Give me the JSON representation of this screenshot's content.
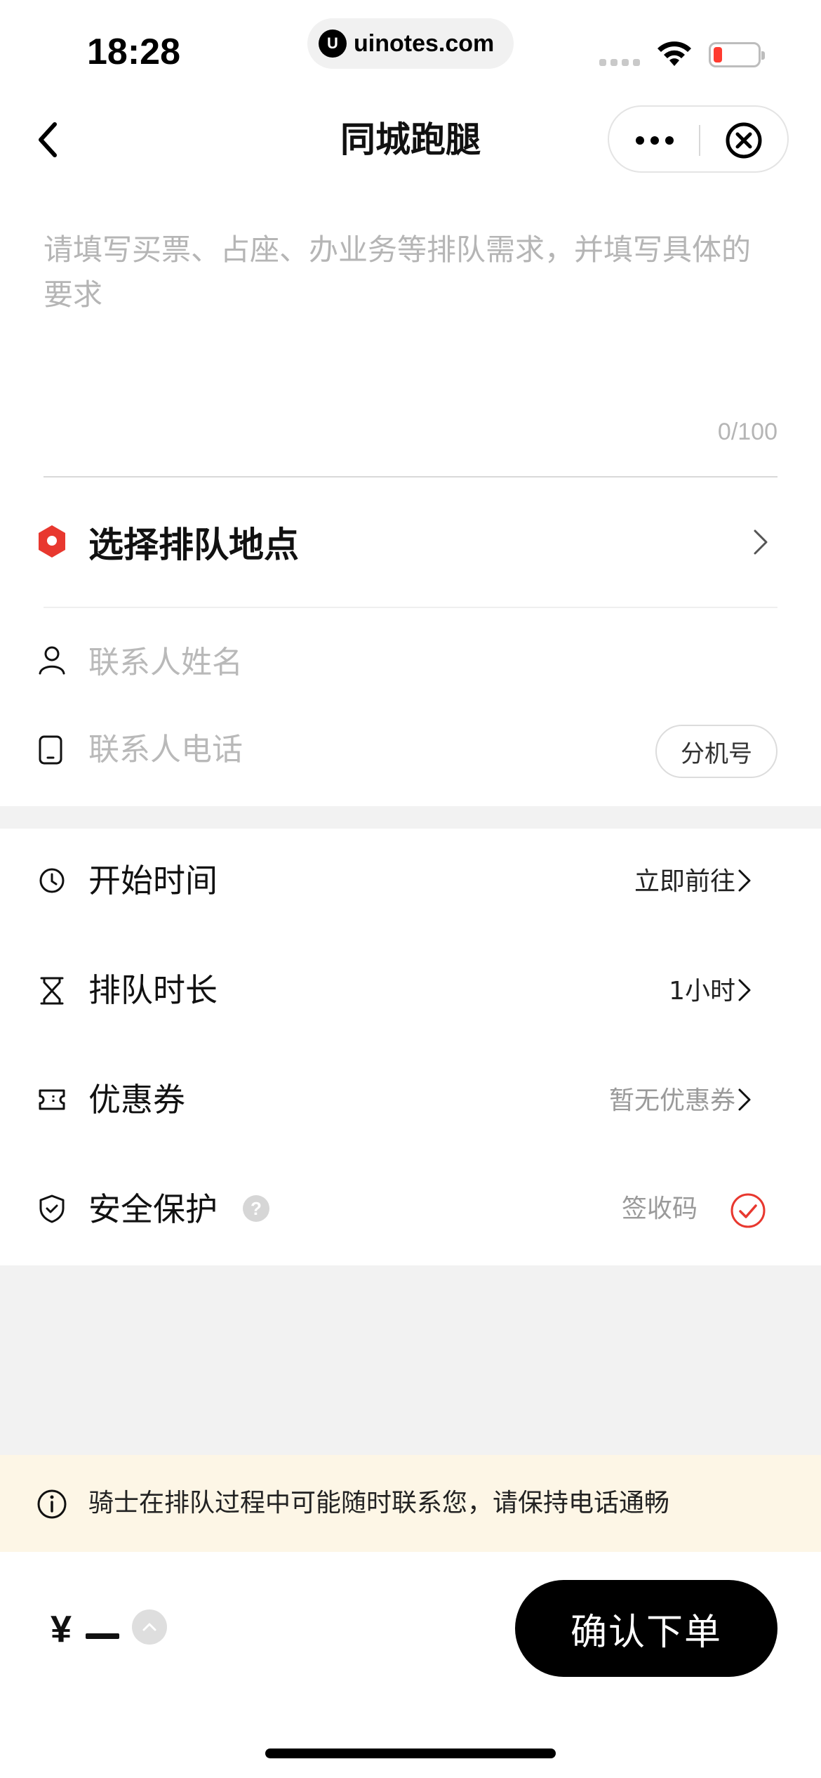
{
  "status_bar": {
    "time": "18:28",
    "url": "uinotes.com",
    "url_logo": "U",
    "battery_color": "#ff3b30"
  },
  "nav": {
    "title": "同城跑腿",
    "back_icon": "chevron-left-icon",
    "more_icon": "more-dots-icon",
    "close_icon": "close-circle-icon"
  },
  "demand": {
    "placeholder": "请填写买票、占座、办业务等排队需求，并填写具体的要求",
    "value": "",
    "char_count": "0/100"
  },
  "location": {
    "label": "选择排队地点",
    "icon": "location-pin-icon",
    "accent_color": "#e8382f"
  },
  "contact": {
    "name_placeholder": "联系人姓名",
    "phone_placeholder": "联系人电话",
    "extension_label": "分机号",
    "name_icon": "person-icon",
    "phone_icon": "phone-icon"
  },
  "options": {
    "start_time": {
      "label": "开始时间",
      "value": "立即前往",
      "icon": "clock-icon"
    },
    "duration": {
      "label": "排队时长",
      "value": "1小时",
      "icon": "hourglass-icon"
    },
    "coupon": {
      "label": "优惠券",
      "value": "暂无优惠券",
      "icon": "ticket-icon"
    },
    "safety": {
      "label": "安全保护",
      "value": "签收码",
      "icon": "shield-icon",
      "help_glyph": "?",
      "checked": true,
      "check_color": "#e8382f"
    }
  },
  "notice": {
    "text": "骑士在排队过程中可能随时联系您，请保持电话通畅",
    "icon": "info-icon",
    "background": "#fdf6e6"
  },
  "footer": {
    "currency": "¥",
    "confirm_label": "确认下单"
  }
}
